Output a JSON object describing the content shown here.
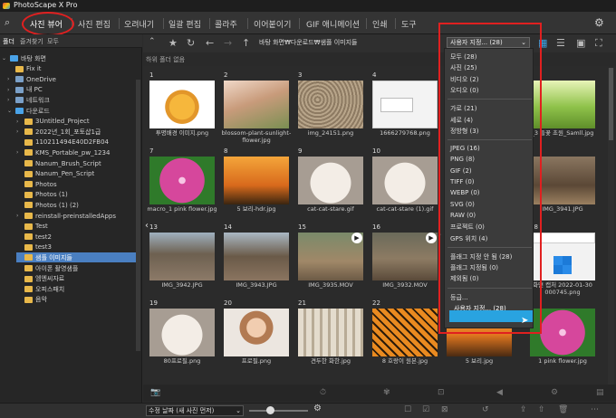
{
  "app": {
    "title": "PhotoScape X Pro"
  },
  "menu": {
    "tabs": [
      "사진 뷰어",
      "사진 편집",
      "오려내기",
      "일괄 편집",
      "콜라주",
      "이어붙이기",
      "GIF 애니메이션",
      "인쇄",
      "도구"
    ],
    "active": "사진 뷰어"
  },
  "left": {
    "tabs": [
      "폴더",
      "즐겨찾기",
      "모두"
    ],
    "tree": [
      {
        "label": "바탕 화면",
        "type": "folder-blue",
        "level": 0,
        "arrow": "⌄"
      },
      {
        "label": "Fix it",
        "type": "folder",
        "level": 1,
        "arrow": ""
      },
      {
        "label": "OneDrive",
        "type": "drive",
        "level": 1,
        "arrow": "›"
      },
      {
        "label": "내 PC",
        "type": "drive",
        "level": 1,
        "arrow": "›"
      },
      {
        "label": "네트워크",
        "type": "drive",
        "level": 1,
        "arrow": "›"
      },
      {
        "label": "다운로드",
        "type": "folder-blue",
        "level": 1,
        "arrow": "⌄"
      },
      {
        "label": "3Untitled_Project",
        "type": "folder",
        "level": 2,
        "arrow": "›"
      },
      {
        "label": "2022년_1회_포토샵1급",
        "type": "folder",
        "level": 2,
        "arrow": "›"
      },
      {
        "label": "110211494E40D2FB04",
        "type": "folder",
        "level": 2,
        "arrow": ""
      },
      {
        "label": "KMS_Portable_pw_1234",
        "type": "folder",
        "level": 2,
        "arrow": "›"
      },
      {
        "label": "Nanum_Brush_Script",
        "type": "folder",
        "level": 2,
        "arrow": ""
      },
      {
        "label": "Nanum_Pen_Script",
        "type": "folder",
        "level": 2,
        "arrow": ""
      },
      {
        "label": "Photos",
        "type": "folder",
        "level": 2,
        "arrow": ""
      },
      {
        "label": "Photos (1)",
        "type": "folder",
        "level": 2,
        "arrow": ""
      },
      {
        "label": "Photos (1) (2)",
        "type": "folder",
        "level": 2,
        "arrow": ""
      },
      {
        "label": "reinstall-preinstalledApps",
        "type": "folder",
        "level": 2,
        "arrow": "›"
      },
      {
        "label": "Test",
        "type": "folder",
        "level": 2,
        "arrow": ""
      },
      {
        "label": "test2",
        "type": "folder",
        "level": 2,
        "arrow": ""
      },
      {
        "label": "test3",
        "type": "folder",
        "level": 2,
        "arrow": ""
      },
      {
        "label": "샘플 이미지들",
        "type": "folder",
        "level": 2,
        "arrow": "",
        "selected": true
      },
      {
        "label": "아이폰 촬영샘플",
        "type": "folder",
        "level": 2,
        "arrow": ""
      },
      {
        "label": "엠엔씨자료",
        "type": "folder",
        "level": 2,
        "arrow": ""
      },
      {
        "label": "오피스패치",
        "type": "folder",
        "level": 2,
        "arrow": ""
      },
      {
        "label": "음악",
        "type": "folder",
        "level": 2,
        "arrow": ""
      }
    ]
  },
  "toolbar": {
    "path": "바탕 화면₩다운로드₩샘플 이미지들",
    "status": "하위 폴더 없음",
    "filter_value": "사용자 지정... (28)"
  },
  "grid": [
    {
      "num": "1",
      "caption": "투명배경 이미지.png",
      "thumb": "tulip"
    },
    {
      "num": "2",
      "caption": "blossom-plant-sunlight-flower.jpg",
      "thumb": "blossom"
    },
    {
      "num": "3",
      "caption": "img_24151.png",
      "thumb": "gravel"
    },
    {
      "num": "4",
      "caption": "1666279768.png",
      "thumb": "screenshot"
    },
    {
      "num": "",
      "caption": "",
      "thumb": "hidden"
    },
    {
      "num": "",
      "caption": "_3 들꽃 초원_Samll.jpg",
      "thumb": "meadow"
    },
    {
      "num": "7",
      "caption": "macro_1 pink flower.jpg",
      "thumb": "pinkflower"
    },
    {
      "num": "8",
      "caption": "5 보리-hdr.jpg",
      "thumb": "sunset"
    },
    {
      "num": "9",
      "caption": "cat-cat-stare.gif",
      "thumb": "cat"
    },
    {
      "num": "10",
      "caption": "cat-cat-stare (1).gif",
      "thumb": "cat"
    },
    {
      "num": "",
      "caption": "",
      "thumb": "hidden"
    },
    {
      "num": "",
      "caption": "IMG_3941.JPG",
      "thumb": "trees"
    },
    {
      "num": "13",
      "caption": "IMG_3942.JPG",
      "thumb": "road"
    },
    {
      "num": "14",
      "caption": "IMG_3943.JPG",
      "thumb": "road2"
    },
    {
      "num": "15",
      "caption": "IMG_3935.MOV",
      "thumb": "path",
      "video": true
    },
    {
      "num": "16",
      "caption": "IMG_3932.MOV",
      "thumb": "path2",
      "video": true
    },
    {
      "num": "",
      "caption": "",
      "thumb": "hidden"
    },
    {
      "num": "18",
      "caption": "화면 캡처 2022-01-30 000745.png",
      "thumb": "windows"
    },
    {
      "num": "19",
      "caption": "80프로필.png",
      "thumb": "cat"
    },
    {
      "num": "20",
      "caption": "프로필.png",
      "thumb": "woman"
    },
    {
      "num": "21",
      "caption": "견두한 화한.jpg",
      "thumb": "statues"
    },
    {
      "num": "22",
      "caption": "8 호랑이 원본.jpg",
      "thumb": "tiger"
    },
    {
      "num": "23",
      "caption": "5 보리.jpg",
      "thumb": "sunset2"
    },
    {
      "num": "",
      "caption": "1 pink flower.jpg",
      "thumb": "pinkflower"
    }
  ],
  "dropdown": {
    "groups": [
      [
        "모두 (28)",
        "사진 (25)",
        "비디오 (2)",
        "오디오 (0)"
      ],
      [
        "가로 (21)",
        "세로 (4)",
        "정방형 (3)"
      ],
      [
        "JPEG (16)",
        "PNG (8)",
        "GIF (2)",
        "TIFF (0)",
        "WEBP (0)",
        "SVG (0)",
        "RAW (0)",
        "프로젝트 (0)",
        "GPS 위치 (4)"
      ],
      [
        "플래그 지정 안 됨 (28)",
        "플래그 지정됨 (0)",
        "제외됨 (0)"
      ],
      [
        "등급...",
        "사용자 지정... (28)"
      ]
    ],
    "highlighted": "사용자 지정... (28)"
  },
  "bottom": {
    "sort_label": "수정 날짜 (새 사진 먼저)"
  },
  "colors": {
    "accent": "#29a3e0",
    "annotation": "#e02020",
    "selection": "#4a7fc1"
  }
}
